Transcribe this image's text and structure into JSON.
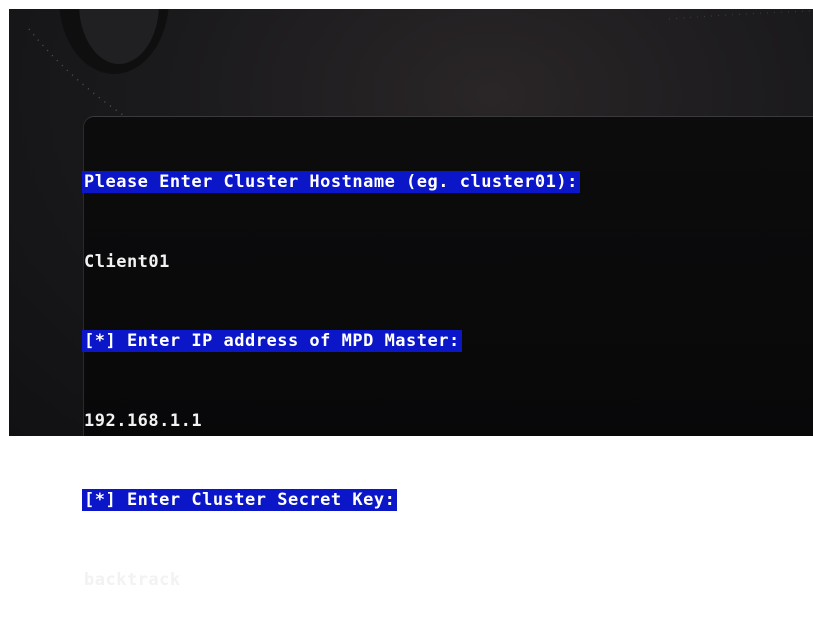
{
  "terminal": {
    "lines": [
      {
        "text": "Please Enter Cluster Hostname (eg. cluster01):",
        "kind": "prompt"
      },
      {
        "text": "Client01",
        "kind": "input"
      },
      {
        "text": "[*] Enter IP address of MPD Master:",
        "kind": "prompt"
      },
      {
        "text": "192.168.1.1",
        "kind": "input"
      },
      {
        "text": "[*] Enter Cluster Secret Key:",
        "kind": "prompt"
      },
      {
        "text": "backtrack",
        "kind": "input"
      }
    ]
  },
  "colors": {
    "prompt_highlight": "#0a16c8",
    "text": "#ffffff",
    "terminal_background": "#0c0c0d",
    "desktop_background": "#1b1a1c"
  },
  "icons": {
    "cursor": "text-cursor-underscore"
  }
}
